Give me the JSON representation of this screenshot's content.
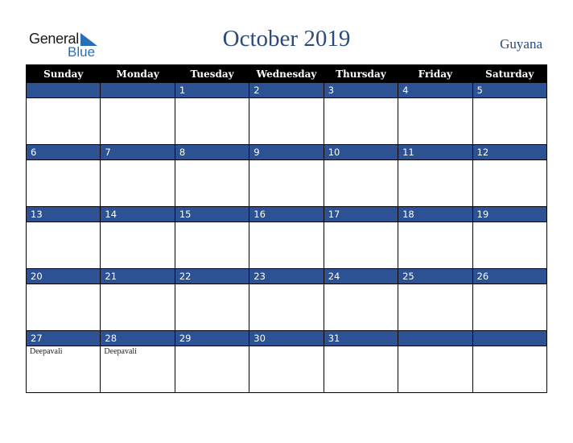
{
  "logo": {
    "line1": "General",
    "line2": "Blue"
  },
  "title": "October 2019",
  "country": "Guyana",
  "colors": {
    "header_bg": "#000000",
    "day_bar": "#2c5294",
    "title": "#2c4a7c",
    "logo_blue": "#2a6fb5"
  },
  "weekdays": [
    "Sunday",
    "Monday",
    "Tuesday",
    "Wednesday",
    "Thursday",
    "Friday",
    "Saturday"
  ],
  "weeks": [
    [
      {
        "day": ""
      },
      {
        "day": ""
      },
      {
        "day": "1"
      },
      {
        "day": "2"
      },
      {
        "day": "3"
      },
      {
        "day": "4"
      },
      {
        "day": "5"
      }
    ],
    [
      {
        "day": "6"
      },
      {
        "day": "7"
      },
      {
        "day": "8"
      },
      {
        "day": "9"
      },
      {
        "day": "10"
      },
      {
        "day": "11"
      },
      {
        "day": "12"
      }
    ],
    [
      {
        "day": "13"
      },
      {
        "day": "14"
      },
      {
        "day": "15"
      },
      {
        "day": "16"
      },
      {
        "day": "17"
      },
      {
        "day": "18"
      },
      {
        "day": "19"
      }
    ],
    [
      {
        "day": "20"
      },
      {
        "day": "21"
      },
      {
        "day": "22"
      },
      {
        "day": "23"
      },
      {
        "day": "24"
      },
      {
        "day": "25"
      },
      {
        "day": "26"
      }
    ],
    [
      {
        "day": "27",
        "event": "Deepavali"
      },
      {
        "day": "28",
        "event": "Deepavali"
      },
      {
        "day": "29"
      },
      {
        "day": "30"
      },
      {
        "day": "31"
      },
      {
        "day": ""
      },
      {
        "day": ""
      }
    ]
  ]
}
